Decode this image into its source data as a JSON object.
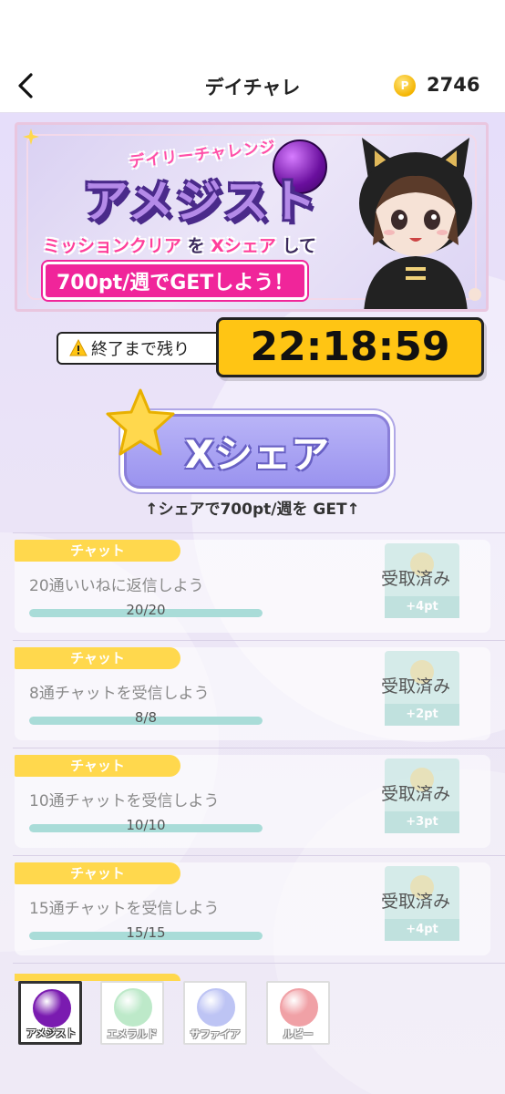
{
  "header": {
    "title": "デイチャレ",
    "coin_symbol": "P",
    "points": "2746"
  },
  "banner": {
    "subtitle": "デイリーチャレンジ",
    "title": "アメジスト",
    "line1_a": "ミッションクリア",
    "line1_b": "を",
    "line1_c": "Xシェア",
    "line1_d": "して",
    "line2": "700pt/週でGETしよう！"
  },
  "timer": {
    "label": "終了まで残り",
    "value": "22:18:59"
  },
  "share": {
    "button_label": "Xシェア",
    "caption": "↑シェアで700pt/週を GET↑"
  },
  "missions": [
    {
      "category": "チャット",
      "title": "20通いいねに返信しよう",
      "progress_text": "20/20",
      "progress": 1.0,
      "reward": "+4pt",
      "status": "受取済み"
    },
    {
      "category": "チャット",
      "title": "8通チャットを受信しよう",
      "progress_text": "8/8",
      "progress": 1.0,
      "reward": "+2pt",
      "status": "受取済み"
    },
    {
      "category": "チャット",
      "title": "10通チャットを受信しよう",
      "progress_text": "10/10",
      "progress": 1.0,
      "reward": "+3pt",
      "status": "受取済み"
    },
    {
      "category": "チャット",
      "title": "15通チャットを受信しよう",
      "progress_text": "15/15",
      "progress": 1.0,
      "reward": "+4pt",
      "status": "受取済み"
    }
  ],
  "gem_tabs": [
    {
      "label": "アメジスト",
      "color": "#7a1bb0",
      "selected": true
    },
    {
      "label": "エメラルド",
      "color": "#6fd08a",
      "selected": false
    },
    {
      "label": "サファイア",
      "color": "#6f7de8",
      "selected": false
    },
    {
      "label": "ルビー",
      "color": "#e0303c",
      "selected": false
    }
  ],
  "colors": {
    "accent_yellow": "#ffc514",
    "tag_yellow": "#ffd84d",
    "share_purple": "#9a93ef",
    "progress_teal": "#a9dcd8"
  }
}
